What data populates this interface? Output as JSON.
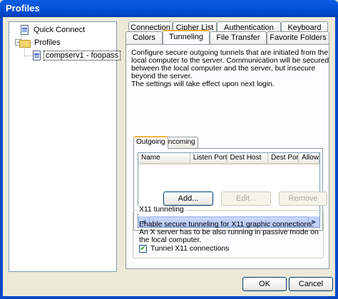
{
  "window": {
    "title": "Profiles"
  },
  "tree": {
    "quick_connect": "Quick Connect",
    "profiles": "Profiles",
    "profile_item": "compserv1 - foopass",
    "expander_symbol": "-"
  },
  "tabs": {
    "row_top": [
      "Connection",
      "Cipher List",
      "Authentication",
      "Keyboard"
    ],
    "row_bottom": [
      "Colors",
      "Tunneling",
      "File Transfer",
      "Favorite Folders"
    ],
    "active": "Tunneling"
  },
  "tunneling": {
    "description": "Configure secure outgoing tunnels that are initiated from the local computer to the server. Communication will be secured between the local computer and the server, but insecure beyond the server.",
    "note": "The settings will take effect upon next login.",
    "inner_tabs": [
      "Outgoing",
      "Incoming"
    ],
    "columns": [
      "Name",
      "Listen Port",
      "Dest Host",
      "Dest Port",
      "Allow"
    ],
    "buttons": {
      "add": "Add...",
      "edit": "Edit...",
      "remove": "Remove"
    },
    "x11": {
      "legend": "X11 tunneling",
      "description": "Enable secure tunneling for X11 graphic connections. An X server has to be also running in passive mode on the local computer.",
      "checkbox_label": "Tunnel X11 connections",
      "checked": true
    }
  },
  "footer": {
    "ok": "OK",
    "cancel": "Cancel"
  },
  "colors": {
    "title_bar": "#0454d8",
    "accent_tab": "#f5b43d",
    "dialog_bg": "#ece9d8"
  }
}
